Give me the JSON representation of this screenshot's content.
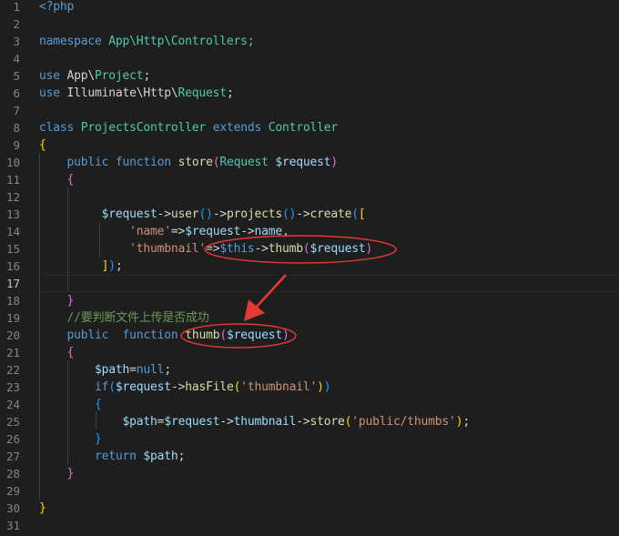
{
  "editor": {
    "lines": [
      {
        "n": "1",
        "tokens": [
          {
            "t": "<?php",
            "c": "kw"
          }
        ]
      },
      {
        "n": "2",
        "tokens": []
      },
      {
        "n": "3",
        "tokens": [
          {
            "t": "namespace",
            "c": "kw"
          },
          {
            "t": " App\\Http\\Controllers;",
            "c": "cls"
          }
        ]
      },
      {
        "n": "4",
        "tokens": []
      },
      {
        "n": "5",
        "tokens": [
          {
            "t": "use",
            "c": "dim"
          },
          {
            "t": " ",
            "c": "pl"
          },
          {
            "t": "App\\",
            "c": "pl"
          },
          {
            "t": "Project",
            "c": "cls"
          },
          {
            "t": ";",
            "c": "pl"
          }
        ]
      },
      {
        "n": "6",
        "tokens": [
          {
            "t": "use",
            "c": "kw"
          },
          {
            "t": " Illuminate\\Http\\",
            "c": "pl"
          },
          {
            "t": "Request",
            "c": "cls"
          },
          {
            "t": ";",
            "c": "pl"
          }
        ]
      },
      {
        "n": "7",
        "tokens": []
      },
      {
        "n": "8",
        "tokens": [
          {
            "t": "class",
            "c": "kw"
          },
          {
            "t": " ",
            "c": "pl"
          },
          {
            "t": "ProjectsController",
            "c": "cls"
          },
          {
            "t": " ",
            "c": "pl"
          },
          {
            "t": "extends",
            "c": "kw"
          },
          {
            "t": " ",
            "c": "pl"
          },
          {
            "t": "Controller",
            "c": "cls"
          }
        ]
      },
      {
        "n": "9",
        "tokens": [
          {
            "t": "{",
            "c": "br1"
          }
        ]
      },
      {
        "n": "10",
        "tokens": [
          {
            "t": "    ",
            "c": "pl"
          },
          {
            "t": "public",
            "c": "kw"
          },
          {
            "t": " ",
            "c": "pl"
          },
          {
            "t": "function",
            "c": "kw"
          },
          {
            "t": " ",
            "c": "pl"
          },
          {
            "t": "store",
            "c": "fn"
          },
          {
            "t": "(",
            "c": "br2"
          },
          {
            "t": "Request",
            "c": "cls"
          },
          {
            "t": " ",
            "c": "pl"
          },
          {
            "t": "$request",
            "c": "var"
          },
          {
            "t": ")",
            "c": "br2"
          }
        ]
      },
      {
        "n": "11",
        "tokens": [
          {
            "t": "    ",
            "c": "pl"
          },
          {
            "t": "{",
            "c": "br2"
          }
        ]
      },
      {
        "n": "12",
        "tokens": []
      },
      {
        "n": "13",
        "tokens": [
          {
            "t": "         ",
            "c": "pl"
          },
          {
            "t": "$request",
            "c": "var"
          },
          {
            "t": "->",
            "c": "pl"
          },
          {
            "t": "user",
            "c": "fn"
          },
          {
            "t": "()",
            "c": "br3"
          },
          {
            "t": "->",
            "c": "pl"
          },
          {
            "t": "projects",
            "c": "fn"
          },
          {
            "t": "()",
            "c": "br3"
          },
          {
            "t": "->",
            "c": "pl"
          },
          {
            "t": "create",
            "c": "fn"
          },
          {
            "t": "(",
            "c": "br3"
          },
          {
            "t": "[",
            "c": "br1"
          }
        ]
      },
      {
        "n": "14",
        "tokens": [
          {
            "t": "             ",
            "c": "pl"
          },
          {
            "t": "'name'",
            "c": "str"
          },
          {
            "t": "=>",
            "c": "pl"
          },
          {
            "t": "$request",
            "c": "var"
          },
          {
            "t": "->",
            "c": "pl"
          },
          {
            "t": "name",
            "c": "var"
          },
          {
            "t": ",",
            "c": "pl"
          }
        ]
      },
      {
        "n": "15",
        "tokens": [
          {
            "t": "             ",
            "c": "pl"
          },
          {
            "t": "'thumbnail'",
            "c": "str"
          },
          {
            "t": "=>",
            "c": "pl"
          },
          {
            "t": "$this",
            "c": "kw"
          },
          {
            "t": "->",
            "c": "pl"
          },
          {
            "t": "thumb",
            "c": "fn"
          },
          {
            "t": "(",
            "c": "br2"
          },
          {
            "t": "$request",
            "c": "var"
          },
          {
            "t": ")",
            "c": "br2"
          }
        ]
      },
      {
        "n": "16",
        "tokens": [
          {
            "t": "         ",
            "c": "pl"
          },
          {
            "t": "]",
            "c": "br1"
          },
          {
            "t": ")",
            "c": "br3"
          },
          {
            "t": ";",
            "c": "pl"
          }
        ]
      },
      {
        "n": "17",
        "tokens": [],
        "active": true
      },
      {
        "n": "18",
        "tokens": [
          {
            "t": "    ",
            "c": "pl"
          },
          {
            "t": "}",
            "c": "br2"
          }
        ]
      },
      {
        "n": "19",
        "tokens": [
          {
            "t": "    ",
            "c": "pl"
          },
          {
            "t": "//要判断文件上传是否成功",
            "c": "cmt"
          }
        ]
      },
      {
        "n": "20",
        "tokens": [
          {
            "t": "    ",
            "c": "pl"
          },
          {
            "t": "public",
            "c": "kw"
          },
          {
            "t": "  ",
            "c": "pl"
          },
          {
            "t": "function",
            "c": "kw"
          },
          {
            "t": " ",
            "c": "pl"
          },
          {
            "t": "thumb",
            "c": "fn"
          },
          {
            "t": "(",
            "c": "br2"
          },
          {
            "t": "$request",
            "c": "var"
          },
          {
            "t": ")",
            "c": "br2"
          }
        ]
      },
      {
        "n": "21",
        "tokens": [
          {
            "t": "    ",
            "c": "pl"
          },
          {
            "t": "{",
            "c": "br2"
          }
        ]
      },
      {
        "n": "22",
        "tokens": [
          {
            "t": "        ",
            "c": "pl"
          },
          {
            "t": "$path",
            "c": "var"
          },
          {
            "t": "=",
            "c": "pl"
          },
          {
            "t": "null",
            "c": "kw"
          },
          {
            "t": ";",
            "c": "pl"
          }
        ]
      },
      {
        "n": "23",
        "tokens": [
          {
            "t": "        ",
            "c": "pl"
          },
          {
            "t": "if",
            "c": "kw"
          },
          {
            "t": "(",
            "c": "br3"
          },
          {
            "t": "$request",
            "c": "var"
          },
          {
            "t": "->",
            "c": "pl"
          },
          {
            "t": "hasFile",
            "c": "fn"
          },
          {
            "t": "(",
            "c": "br1"
          },
          {
            "t": "'thumbnail'",
            "c": "str"
          },
          {
            "t": ")",
            "c": "br1"
          },
          {
            "t": ")",
            "c": "br3"
          }
        ]
      },
      {
        "n": "24",
        "tokens": [
          {
            "t": "        ",
            "c": "pl"
          },
          {
            "t": "{",
            "c": "br3"
          }
        ]
      },
      {
        "n": "25",
        "tokens": [
          {
            "t": "            ",
            "c": "pl"
          },
          {
            "t": "$path",
            "c": "var"
          },
          {
            "t": "=",
            "c": "pl"
          },
          {
            "t": "$request",
            "c": "var"
          },
          {
            "t": "->",
            "c": "pl"
          },
          {
            "t": "thumbnail",
            "c": "var"
          },
          {
            "t": "->",
            "c": "pl"
          },
          {
            "t": "store",
            "c": "fn"
          },
          {
            "t": "(",
            "c": "br1"
          },
          {
            "t": "'public/thumbs'",
            "c": "str"
          },
          {
            "t": ")",
            "c": "br1"
          },
          {
            "t": ";",
            "c": "pl"
          }
        ]
      },
      {
        "n": "26",
        "tokens": [
          {
            "t": "        ",
            "c": "pl"
          },
          {
            "t": "}",
            "c": "br3"
          }
        ]
      },
      {
        "n": "27",
        "tokens": [
          {
            "t": "        ",
            "c": "pl"
          },
          {
            "t": "return",
            "c": "kw"
          },
          {
            "t": " ",
            "c": "pl"
          },
          {
            "t": "$path",
            "c": "var"
          },
          {
            "t": ";",
            "c": "pl"
          }
        ]
      },
      {
        "n": "28",
        "tokens": [
          {
            "t": "    ",
            "c": "pl"
          },
          {
            "t": "}",
            "c": "br2"
          }
        ]
      },
      {
        "n": "29",
        "tokens": []
      },
      {
        "n": "30",
        "tokens": [
          {
            "t": "}",
            "c": "br1"
          }
        ]
      },
      {
        "n": "31",
        "tokens": []
      }
    ]
  },
  "annotation": {
    "circle_color": "#e53935",
    "arrow_color": "#e53935"
  }
}
